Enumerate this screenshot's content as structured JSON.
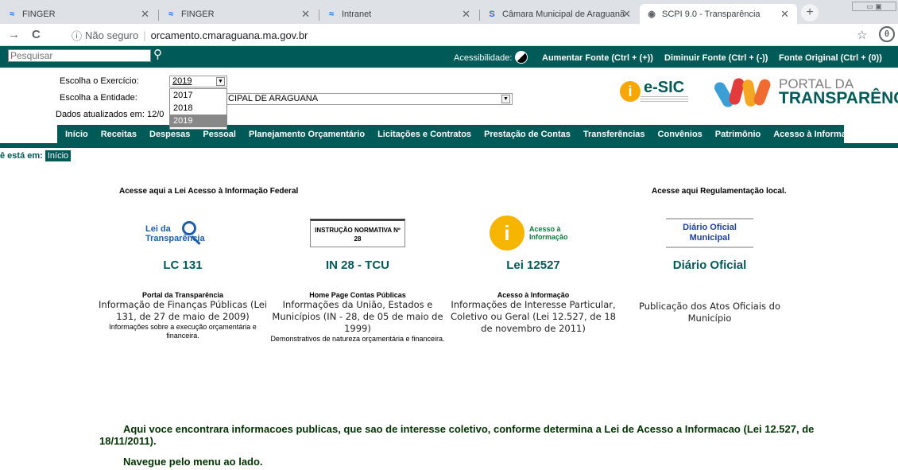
{
  "browser": {
    "tabs": [
      {
        "title": "FINGER",
        "icon": "finger-icon"
      },
      {
        "title": "FINGER",
        "icon": "finger-icon"
      },
      {
        "title": "Intranet",
        "icon": "finger-icon"
      },
      {
        "title": "Câmara Municipal de Araguanã",
        "icon": "camara-s-icon"
      },
      {
        "title": "SCPI 9.0 - Transparência",
        "icon": "globe-icon"
      }
    ],
    "security_label": "Não seguro",
    "url": "orcamento.cmaraguana.ma.gov.br"
  },
  "topbar": {
    "search_placeholder": "Pesquisar",
    "accessibility_label": "Acessibilidade:",
    "increase_font": "Aumentar Fonte (Ctrl + (+))",
    "decrease_font": "Diminuir Fonte (Ctrl + (-))",
    "original_font": "Fonte Original (Ctrl + (0))"
  },
  "filters": {
    "year_label": "Escolha o Exercício:",
    "year_value": "2019",
    "year_options": [
      "2017",
      "2018",
      "2019"
    ],
    "entity_label": "Escolha a Entidade:",
    "entity_value": "CIPAL DE ARAGUANA",
    "updated_label": "Dados atualizados em: 12/0"
  },
  "brand": {
    "esic": "e-SIC",
    "portal_line1": "PORTAL DA",
    "portal_line2": "TRANSPARÊNCIA"
  },
  "nav": [
    "Início",
    "Receitas",
    "Despesas",
    "Pessoal",
    "Planejamento Orçamentário",
    "Licitações e Contratos",
    "Prestação de Contas",
    "Transferências",
    "Convênios",
    "Patrimônio",
    "Acesso à Informação"
  ],
  "breadcrumb": {
    "label": "ê está em:",
    "current": "Início"
  },
  "sections": {
    "federal_header": "Acesse aqui a Lei Acesso à Informação Federal",
    "local_header": "Acesse aqui Regulamentação local."
  },
  "cards": [
    {
      "logo_text": "Lei da Transparência",
      "code": "LC 131",
      "caption": "Portal da Transparência",
      "desc": "Informação de Finanças Públicas (Lei 131, de 27 de maio de 2009)",
      "note": "Informações sobre a execução orçamentária e financeira."
    },
    {
      "logo_text": "INSTRUÇÃO NORMATIVA Nº 28",
      "code": "IN 28 - TCU",
      "caption": "Home Page Contas Públicas",
      "desc": "Informações da União, Estados e Municípios (IN - 28, de 05 de maio de 1999)",
      "note": "Demonstrativos de natureza orçamentária e financeira."
    },
    {
      "logo_text": "Acesso à Informação",
      "code": "Lei 12527",
      "caption": "Acesso à Informação",
      "desc": "Informações de Interesse Particular, Coletivo ou Geral (Lei 12.527, de 18 de novembro de 2011)",
      "note": ""
    },
    {
      "logo_text": "Diário Oficial Municipal",
      "code": "Diário Oficial",
      "caption": "",
      "desc": "Publicação dos Atos Oficiais do Município",
      "note": ""
    }
  ],
  "info_text": "Aqui voce encontrara informacoes publicas, que sao de interesse coletivo, conforme determina a Lei de Acesso a Informacao (Lei 12.527, de 18/11/2011).",
  "navigate_text": "Navegue pelo menu ao lado."
}
